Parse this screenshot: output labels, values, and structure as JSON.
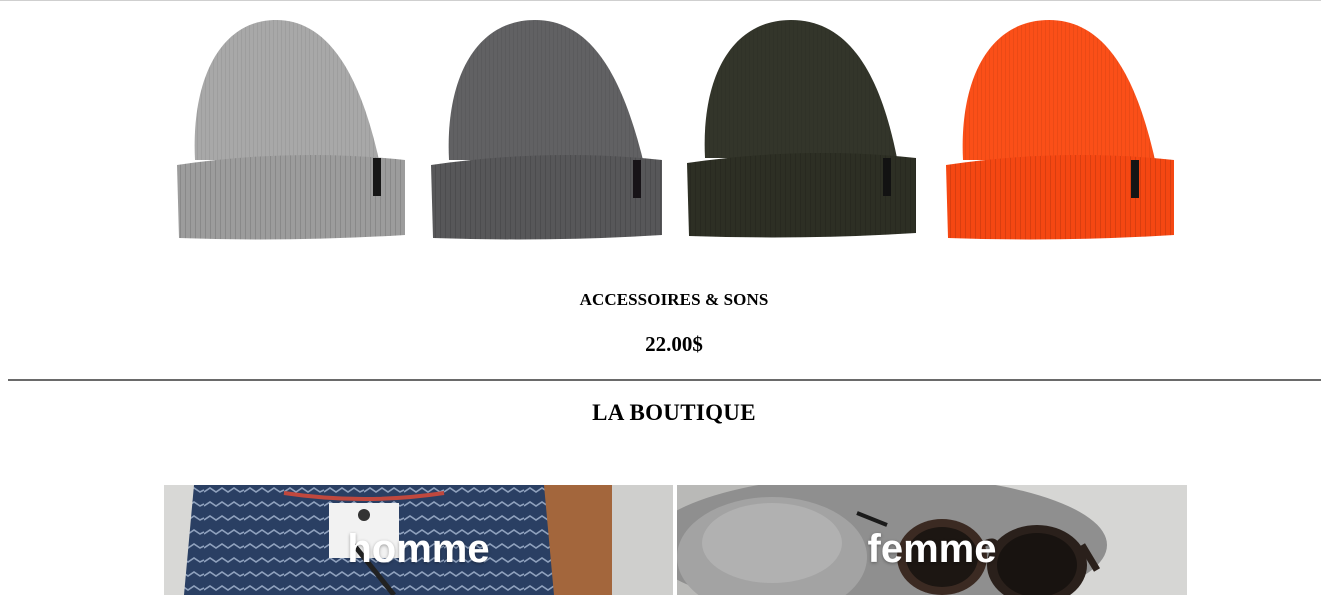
{
  "product": {
    "image_icons": [
      "beanie-light-grey-icon",
      "beanie-charcoal-icon",
      "beanie-olive-icon",
      "beanie-orange-icon"
    ],
    "name": "ACCESSOIRES & SONS",
    "price": "22.00$"
  },
  "colors": {
    "beanie_light_grey": "#a3a3a3",
    "beanie_charcoal": "#5e5e60",
    "beanie_olive": "#2f3125",
    "beanie_orange": "#fb4d17",
    "divider": "#6a6a6a"
  },
  "shop": {
    "title": "LA BOUTIQUE",
    "categories": [
      {
        "label": "homme",
        "icon": "menswear-flatlay-icon"
      },
      {
        "label": "femme",
        "icon": "hat-and-sunglasses-icon"
      }
    ]
  }
}
